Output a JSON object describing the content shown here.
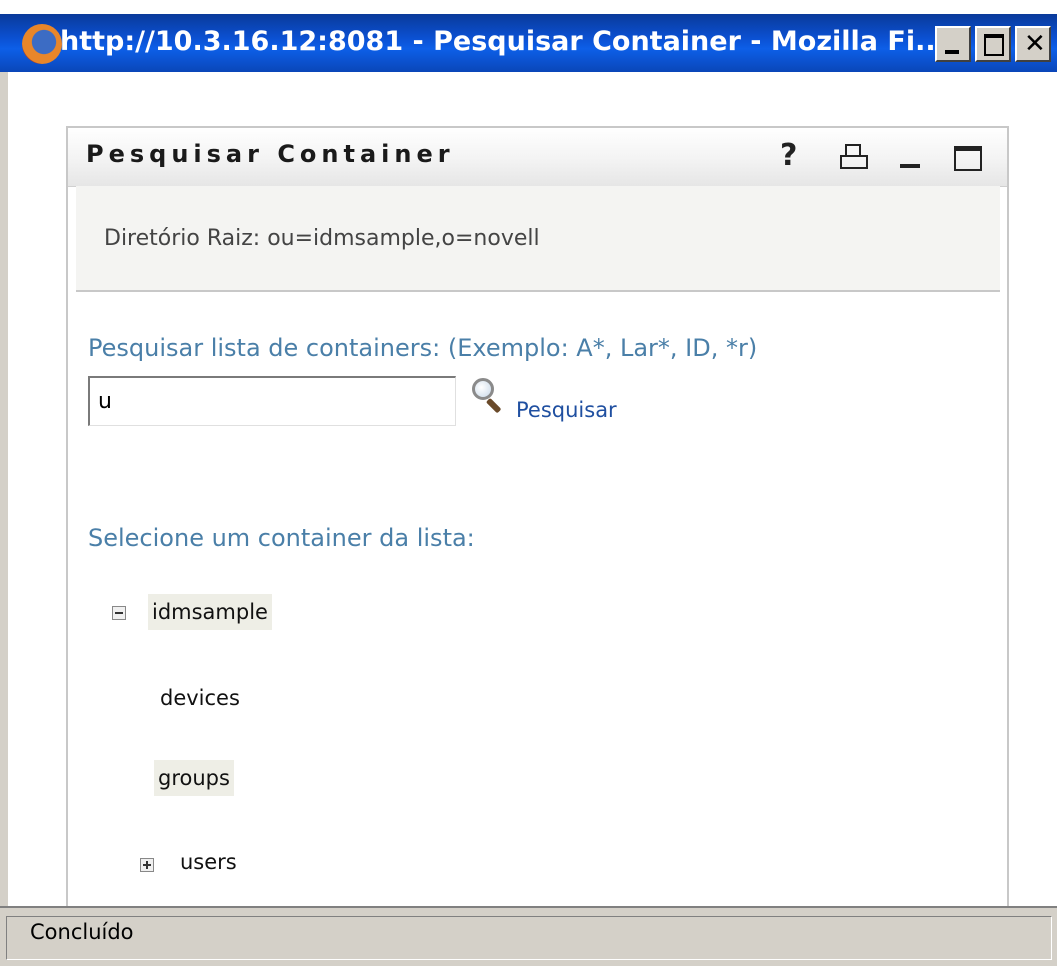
{
  "window": {
    "title": "http://10.3.16.12:8081 - Pesquisar Container - Mozilla Fi..."
  },
  "panel": {
    "title": "Pesquisar Container",
    "root_label": "Diretório Raiz: ou=idmsample,o=novell",
    "search_label": "Pesquisar lista de containers: (Exemplo: A*, Lar*, ID, *r)",
    "search_value": "u",
    "search_link": "Pesquisar",
    "select_label": "Selecione um container da lista:",
    "tree": [
      {
        "label": "idmsample",
        "expanded": true
      },
      {
        "label": "devices"
      },
      {
        "label": "groups"
      },
      {
        "label": "users",
        "expanded": false
      }
    ]
  },
  "status": {
    "text": "Concluído"
  },
  "icons": [
    "firefox-icon",
    "help-icon",
    "print-icon",
    "minimize-icon",
    "maximize-icon",
    "search-icon"
  ]
}
